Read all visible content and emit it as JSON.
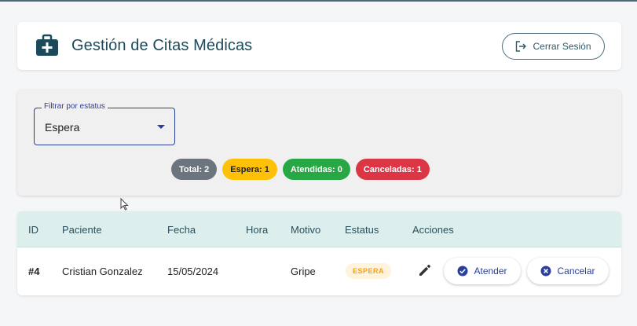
{
  "header": {
    "title": "Gestión de Citas Médicas",
    "logout_label": "Cerrar Sesión",
    "brand_color": "#1b4a5a"
  },
  "filter": {
    "label": "Filtrar por estatus",
    "selected": "Espera"
  },
  "stats": [
    {
      "label": "Total: 2",
      "color": "#6c757d"
    },
    {
      "label": "Espera: 1",
      "color": "#ffc107"
    },
    {
      "label": "Atendidas: 0",
      "color": "#28a745"
    },
    {
      "label": "Canceladas: 1",
      "color": "#dc3545"
    }
  ],
  "table": {
    "columns": [
      "ID",
      "Paciente",
      "Fecha",
      "Hora",
      "Motivo",
      "Estatus",
      "Acciones"
    ],
    "rows": [
      {
        "id": "#4",
        "paciente": "Cristian Gonzalez",
        "fecha": "15/05/2024",
        "hora": "",
        "motivo": "Gripe",
        "estatus": "ESPERA",
        "actions": {
          "attend": "Atender",
          "cancel": "Cancelar"
        }
      }
    ]
  },
  "icons": {
    "logo": "medical-kit-icon",
    "logout": "logout-icon",
    "edit": "pencil-icon",
    "attend": "check-circle-icon",
    "cancel": "x-circle-icon"
  }
}
